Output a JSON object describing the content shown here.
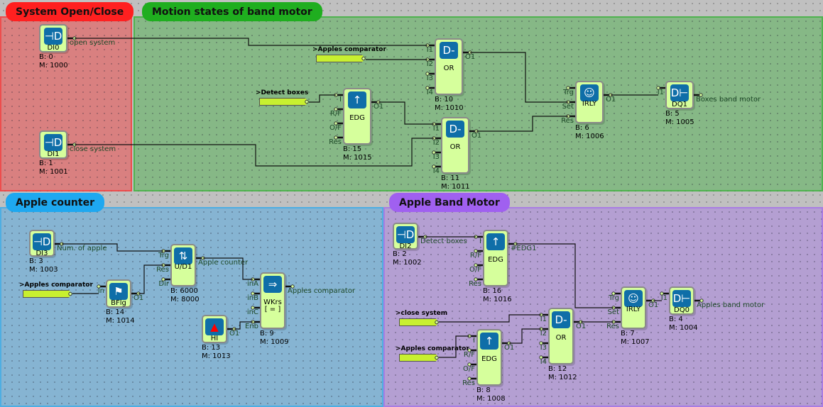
{
  "groups": [
    {
      "id": "sys",
      "title": "System Open/Close",
      "color": "#ff2020",
      "panel": "#d98080"
    },
    {
      "id": "motion",
      "title": "Motion states of band motor",
      "color": "#1fae1f",
      "panel": "#86b886"
    },
    {
      "id": "counter",
      "title": "Apple counter",
      "color": "#1ea8f0",
      "panel": "#86b4d2"
    },
    {
      "id": "band",
      "title": "Apple Band Motor",
      "color": "#a060f0",
      "panel": "#b49fd2"
    }
  ],
  "blocks": [
    {
      "id": "di0",
      "name": "DI0",
      "icon": "digital-input-icon",
      "b": "B: 0",
      "m": "M: 1000",
      "out": "open system",
      "inputs": []
    },
    {
      "id": "di1",
      "name": "DI1",
      "icon": "digital-input-icon",
      "b": "B: 1",
      "m": "M: 1001",
      "out": "close system",
      "inputs": []
    },
    {
      "id": "edg15",
      "name": "EDG",
      "icon": "edge-arrow-icon",
      "b": "B: 15",
      "m": "M: 1015",
      "out": "O1",
      "inputs": [
        "I",
        "R/F",
        "O/F",
        "Res"
      ]
    },
    {
      "id": "or10",
      "name": "OR",
      "icon": "or-gate-icon",
      "b": "B: 10",
      "m": "M: 1010",
      "out": "O1",
      "inputs": [
        "I1",
        "I2",
        "I3",
        "I4"
      ]
    },
    {
      "id": "or11",
      "name": "OR",
      "icon": "or-gate-icon",
      "b": "B: 11",
      "m": "M: 1011",
      "out": "O1",
      "inputs": [
        "I1",
        "I2",
        "I3",
        "I4"
      ]
    },
    {
      "id": "irly6",
      "name": "IRLY",
      "icon": "relay-head-icon",
      "b": "B: 6",
      "m": "M: 1006",
      "out": "O1",
      "inputs": [
        "Trg",
        "Set",
        "Res"
      ]
    },
    {
      "id": "dq1",
      "name": "DQ1",
      "icon": "digital-output-icon",
      "b": "B: 5",
      "m": "M: 1005",
      "out": "Boxes band motor",
      "inputs": [
        "I1"
      ]
    },
    {
      "id": "di3",
      "name": "DI3",
      "icon": "digital-input-icon",
      "b": "B: 3",
      "m": "M: 1003",
      "out": "Num. of apple",
      "inputs": []
    },
    {
      "id": "bflg",
      "name": "BFlg",
      "icon": "flag-icon",
      "b": "B: 14",
      "m": "M: 1014",
      "out": "O1",
      "inputs": [
        "In"
      ]
    },
    {
      "id": "ud1",
      "name": "U/D1",
      "icon": "up-down-counter-icon",
      "b": "B: 6000",
      "m": "M: 8000",
      "out": "Apple counter",
      "inputs": [
        "Trg",
        "Res",
        "Dir"
      ]
    },
    {
      "id": "wkrs",
      "name": "WKrs\n[ = ]",
      "icon": "comparator-icon",
      "b": "B: 9",
      "m": "M: 1009",
      "out": "Apples comparator",
      "inputs": [
        "inA",
        "inB",
        "inC",
        "Enb"
      ]
    },
    {
      "id": "hi",
      "name": "HI",
      "icon": "high-arrow-icon",
      "b": "B: 13",
      "m": "M: 1013",
      "out": "O1",
      "inputs": []
    },
    {
      "id": "di2",
      "name": "DI2",
      "icon": "digital-input-icon",
      "b": "B: 2",
      "m": "M: 1002",
      "out": "Detect boxes",
      "inputs": []
    },
    {
      "id": "edg16",
      "name": "EDG",
      "icon": "edge-arrow-icon",
      "b": "B: 16",
      "m": "M: 1016",
      "out": "#EDG1",
      "inputs": [
        "I",
        "R/F",
        "O/F",
        "Res"
      ]
    },
    {
      "id": "edg8",
      "name": "EDG",
      "icon": "edge-arrow-icon",
      "b": "B: 8",
      "m": "M: 1008",
      "out": "O1",
      "inputs": [
        "I",
        "R/F",
        "O/F",
        "Res"
      ]
    },
    {
      "id": "or12",
      "name": "OR",
      "icon": "or-gate-icon",
      "b": "B: 12",
      "m": "M: 1012",
      "out": "O1",
      "inputs": [
        "I1",
        "I2",
        "I3",
        "I4"
      ]
    },
    {
      "id": "irly7",
      "name": "IRLY",
      "icon": "relay-head-icon",
      "b": "B: 7",
      "m": "M: 1007",
      "out": "O1",
      "inputs": [
        "Trg",
        "Set",
        "Res"
      ]
    },
    {
      "id": "dq0",
      "name": "DQ0",
      "icon": "digital-output-icon",
      "b": "B: 4",
      "m": "M: 1004",
      "out": "Apples band motor",
      "inputs": [
        "I1"
      ]
    }
  ],
  "tags": [
    {
      "id": "t1",
      "label": ">Apples comparator"
    },
    {
      "id": "t2",
      "label": ">Detect boxes"
    },
    {
      "id": "t3",
      "label": ">Apples comparator"
    },
    {
      "id": "t4",
      "label": ">close system"
    },
    {
      "id": "t5",
      "label": ">Apples comparator"
    }
  ]
}
